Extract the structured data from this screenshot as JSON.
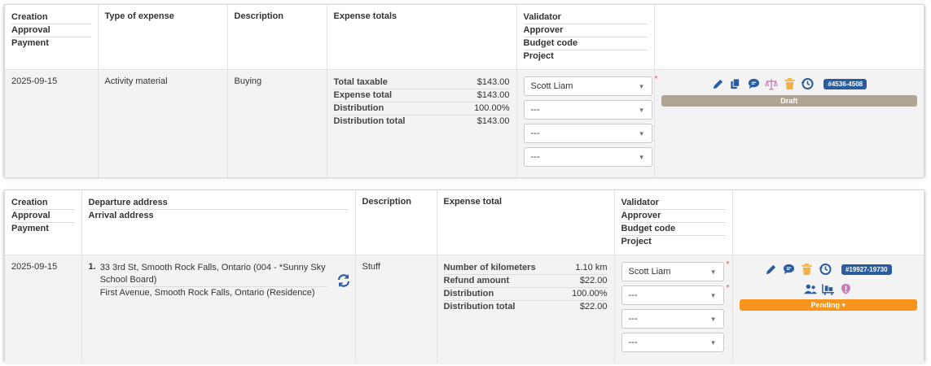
{
  "card1": {
    "headers": {
      "dates": [
        "Creation",
        "Approval",
        "Payment"
      ],
      "type": "Type of expense",
      "description": "Description",
      "totals": "Expense totals",
      "roles": [
        "Validator",
        "Approver",
        "Budget code",
        "Project"
      ]
    },
    "row": {
      "date": "2025-09-15",
      "type": "Activity material",
      "description": "Buying",
      "totals": [
        {
          "label": "Total taxable",
          "value": "$143.00"
        },
        {
          "label": "Expense total",
          "value": "$143.00"
        },
        {
          "label": "Distribution",
          "value": "100.00%"
        },
        {
          "label": "Distribution total",
          "value": "$143.00"
        }
      ],
      "selects": [
        "Scott Liam",
        "---",
        "---",
        "---"
      ],
      "ref_badge": "#4536-4508",
      "status": "Draft"
    }
  },
  "card2": {
    "headers": {
      "dates": [
        "Creation",
        "Approval",
        "Payment"
      ],
      "address": [
        "Departure address",
        "Arrival address"
      ],
      "description": "Description",
      "totals": "Expense total",
      "roles": [
        "Validator",
        "Approver",
        "Budget code",
        "Project"
      ]
    },
    "row": {
      "date": "2025-09-15",
      "address_number": "1.",
      "departure": "33 3rd St, Smooth Rock Falls, Ontario (004 - *Sunny Sky School Board)",
      "arrival": "First Avenue, Smooth Rock Falls, Ontario (Residence)",
      "description": "Stuff",
      "totals": [
        {
          "label": "Number of kilometers",
          "value": "1.10 km"
        },
        {
          "label": "Refund amount",
          "value": "$22.00"
        },
        {
          "label": "Distribution",
          "value": "100.00%"
        },
        {
          "label": "Distribution total",
          "value": "$22.00"
        }
      ],
      "selects": [
        "Scott Liam",
        "---",
        "---",
        "---"
      ],
      "ref_badge": "#19927-19730",
      "status": "Pending ▾"
    }
  },
  "colors": {
    "accent": "#2a5d9f",
    "draft": "#b1a493",
    "pending": "#f7941d",
    "required": "#d9534f",
    "delete": "#f2b04a",
    "alert": "#c77dbb"
  }
}
